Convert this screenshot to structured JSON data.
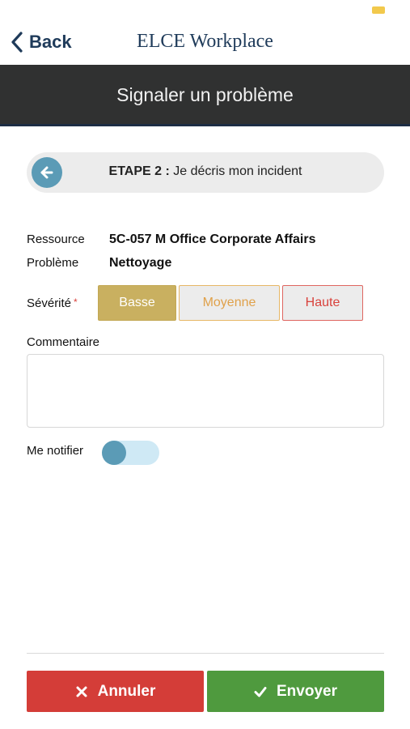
{
  "navbar": {
    "back_label": "Back",
    "app_title": "ELCE Workplace"
  },
  "header": {
    "title": "Signaler un problème"
  },
  "step": {
    "label": "ETAPE 2 :",
    "description": "Je décris mon incident"
  },
  "fields": {
    "resource_label": "Ressource",
    "resource_value": "5C-057 M Office Corporate Affairs",
    "problem_label": "Problème",
    "problem_value": "Nettoyage",
    "severity_label": "Sévérité",
    "required_mark": "*",
    "comment_label": "Commentaire",
    "comment_value": "",
    "notify_label": "Me notifier",
    "notify_enabled": false
  },
  "severity": {
    "options": [
      "Basse",
      "Moyenne",
      "Haute"
    ],
    "selected": "Basse"
  },
  "actions": {
    "cancel_label": "Annuler",
    "send_label": "Envoyer"
  },
  "colors": {
    "nav_text": "#1f3b5a",
    "header_bg": "#303131",
    "accent_blue": "#5b9bb6",
    "severity_low": "#c9b060",
    "severity_medium": "#e0a14a",
    "severity_high": "#d9423c",
    "cancel": "#d43d38",
    "send": "#4f9a3e"
  }
}
